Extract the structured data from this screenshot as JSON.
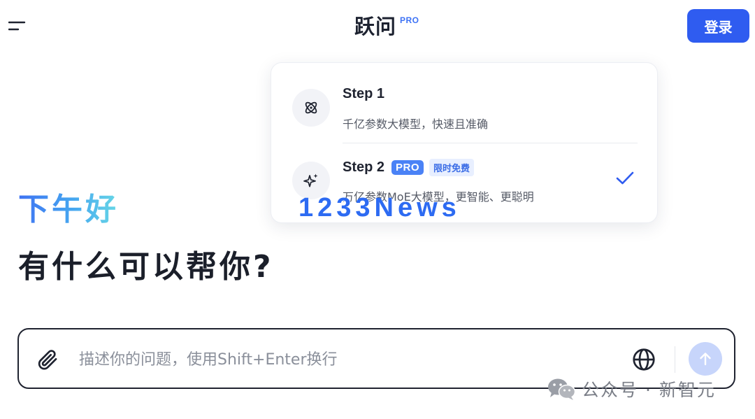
{
  "header": {
    "brand_name": "跃问",
    "brand_badge": "PRO",
    "login_label": "登录"
  },
  "model_menu": {
    "options": [
      {
        "title": "Step 1",
        "description": "千亿参数大模型，快速且准确",
        "icon": "atom-icon",
        "selected": false
      },
      {
        "title": "Step 2",
        "pro_tag": "PRO",
        "promo_tag": "限时免费",
        "description": "万亿参数MoE大模型，更智能、更聪明",
        "icon": "sparkle-icon",
        "selected": true
      }
    ]
  },
  "greeting": {
    "line1": "下午好",
    "line2": "有什么可以帮你?"
  },
  "composer": {
    "placeholder": "描述你的问题，使用Shift+Enter换行",
    "value": ""
  },
  "watermarks": {
    "news": "1233News",
    "wechat": "公众号 · 新智元"
  },
  "colors": {
    "accent": "#2f5cf0",
    "pro_badge": "#4a82f6",
    "send_disabled": "#c7d5fb",
    "greeting_gradient_start": "#3e72f2",
    "greeting_gradient_end": "#68d8e6"
  }
}
